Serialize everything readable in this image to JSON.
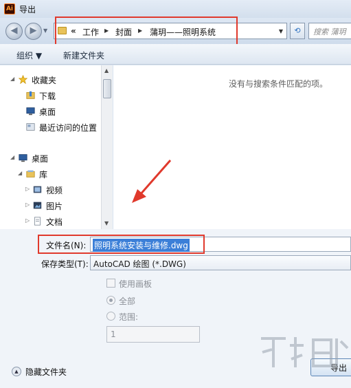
{
  "window": {
    "title": "导出",
    "app_icon_text": "Ai"
  },
  "nav": {
    "back_icon": "back-arrow-icon",
    "forward_icon": "forward-arrow-icon",
    "breadcrumb_lead": "«",
    "breadcrumbs": [
      "工作",
      "封面",
      "蒲玥——照明系统"
    ],
    "search_placeholder": "搜索 蒲玥"
  },
  "toolbar": {
    "organize": "组织 ▼",
    "new_folder": "新建文件夹"
  },
  "tree": {
    "favorites": "收藏夹",
    "downloads": "下载",
    "desktop_fav": "桌面",
    "recent": "最近访问的位置",
    "desktop": "桌面",
    "library": "库",
    "videos": "视频",
    "pictures": "图片",
    "documents": "文档"
  },
  "filepane": {
    "empty_message": "没有与搜索条件匹配的项。"
  },
  "form": {
    "filename_label": "文件名(N):",
    "filename_value": "照明系统安装与维修.dwg",
    "type_label": "保存类型(T):",
    "type_value": "AutoCAD 绘图 (*.DWG)",
    "use_artboards": "使用画板",
    "all": "全部",
    "range": "范围:",
    "range_value": "1",
    "hide_folders": "隐藏文件夹",
    "export_button": "导出"
  },
  "colors": {
    "annotation": "#e0392c",
    "selection": "#3b7fd8"
  }
}
